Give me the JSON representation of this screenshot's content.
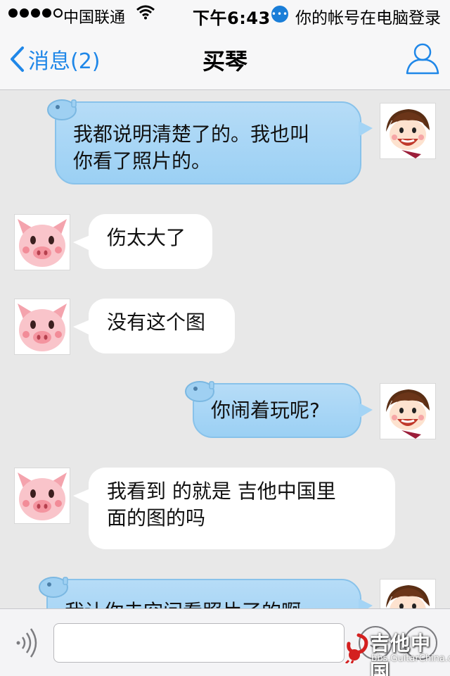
{
  "status_bar": {
    "carrier": "中国联通",
    "time": "下午6:43",
    "notification": "你的帐号在电脑登录",
    "signal_bars_filled": 4,
    "signal_bars_total": 5
  },
  "nav": {
    "back_label": "消息(2)",
    "title": "买琴",
    "accent_color": "#1f87e8"
  },
  "messages": [
    {
      "from": "me",
      "avatar": "cartoon-boy",
      "text": "我都说明清楚了的。我也叫\n你看了照片的。"
    },
    {
      "from": "other",
      "avatar": "cartoon-pig",
      "text": "伤太大了"
    },
    {
      "from": "other",
      "avatar": "cartoon-pig",
      "text": "没有这个图"
    },
    {
      "from": "me",
      "avatar": "cartoon-boy",
      "text": "你闹着玩呢?"
    },
    {
      "from": "other",
      "avatar": "cartoon-pig",
      "text": "我看到 的就是 吉他中国里\n面的图的吗"
    },
    {
      "from": "me",
      "avatar": "cartoon-boy",
      "text": "我让你去空间看照片了的啊"
    }
  ],
  "input_bar": {
    "placeholder": "",
    "voice_icon": "voice-icon",
    "emoji_icon": "emoji-icon",
    "plus_icon": "plus-icon"
  },
  "watermark": {
    "text": "吉他中国",
    "url": "bbs.GuitarChina.com"
  },
  "colors": {
    "chat_background": "#e8e8e8",
    "outgoing_bubble": "#a4d4f5",
    "incoming_bubble": "#ffffff"
  }
}
